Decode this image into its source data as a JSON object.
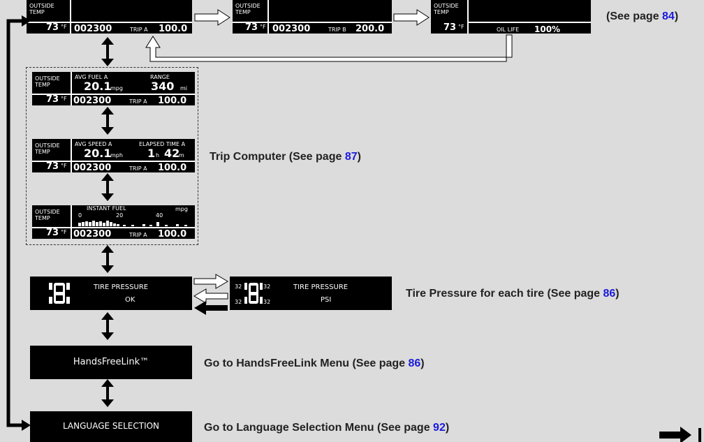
{
  "labels": {
    "outside": "OUTSIDE",
    "temp": "TEMP",
    "temp_value": "73",
    "temp_unit": "°F",
    "odometer": "002300"
  },
  "top_displays": [
    {
      "trip_label": "TRIP A",
      "trip_value": "100.0"
    },
    {
      "trip_label": "TRIP B",
      "trip_value": "200.0"
    },
    {
      "oil_label": "OIL LIFE",
      "oil_value": "100%"
    }
  ],
  "top_annotation": {
    "prefix": "(See page ",
    "page": "84",
    "suffix": ")"
  },
  "trip_computer": {
    "screens": [
      {
        "left_label": "AVG FUEL A",
        "left_value": "20.1",
        "left_unit": "mpg",
        "right_label": "RANGE",
        "right_value": "340",
        "right_unit": "mi",
        "trip_label": "TRIP A",
        "trip_value": "100.0"
      },
      {
        "left_label": "AVG SPEED A",
        "left_value": "20.1",
        "left_unit": "mph",
        "right_label": "ELAPSED TIME A",
        "right_h": "1",
        "right_h_unit": "h",
        "right_m": "42",
        "right_m_unit": "m",
        "trip_label": "TRIP A",
        "trip_value": "100.0"
      },
      {
        "label": "INSTANT FUEL",
        "unit": "mpg",
        "scale": [
          "0",
          "20",
          "40"
        ],
        "trip_label": "TRIP A",
        "trip_value": "100.0"
      }
    ],
    "annotation": {
      "text": "Trip Computer (See page ",
      "page": "87",
      "suffix": ")"
    }
  },
  "tire_pressure": {
    "title": "TIRE PRESSURE",
    "status": "OK",
    "unit": "PSI",
    "values": [
      "32",
      "32",
      "32",
      "32"
    ],
    "annotation": {
      "text": "Tire Pressure for each tire (See page ",
      "page": "86",
      "suffix": ")"
    }
  },
  "handsfreelink": {
    "label": "HandsFreeLink™",
    "annotation": {
      "text": "Go to HandsFreeLink Menu (See page ",
      "page": "86",
      "suffix": ")"
    }
  },
  "language": {
    "label": "LANGUAGE SELECTION",
    "annotation": {
      "text": "Go to Language Selection Menu (See page ",
      "page": "92",
      "suffix": ")"
    }
  },
  "colors": {
    "background": "#dcdcdc",
    "display": "#000000",
    "display_text": "#ffffff",
    "page_link": "#1a1adc",
    "annotation": "#222222"
  }
}
